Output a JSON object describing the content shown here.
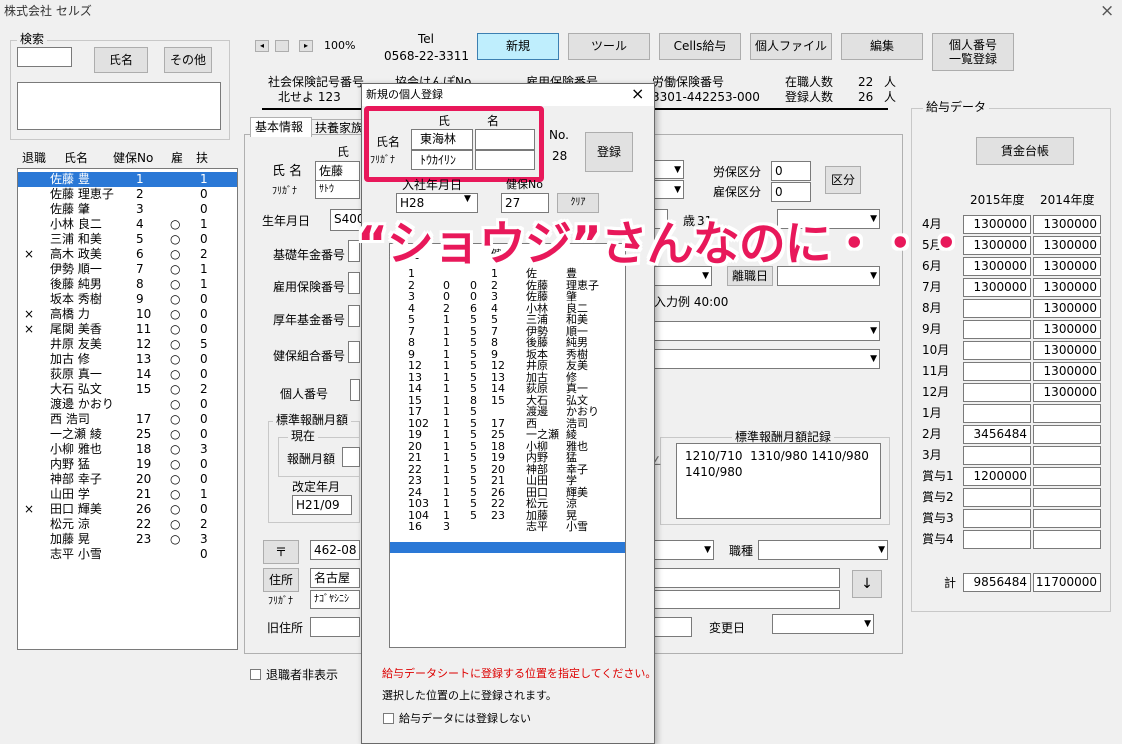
{
  "window": {
    "title": "株式会社 セルズ",
    "close": "×"
  },
  "search": {
    "legend": "検索",
    "name_btn": "氏名",
    "other_btn": "その他"
  },
  "nav": {
    "zoom": "100%",
    "tel_label": "Tel",
    "tel_value": "0568-22-3311"
  },
  "toolbar": {
    "new": "新規",
    "tool": "ツール",
    "cells_pay": "Cells給与",
    "personal_file": "個人ファイル",
    "edit": "編集",
    "my_number": "個人番号\n一覧登録"
  },
  "info": {
    "social_insurance_label": "社会保険記号番号",
    "social_insurance_value": "北せよ 123",
    "kyokai_label": "協会けんぽNo",
    "koyo_label": "雇用保険番号",
    "labor_label": "労働保険番号",
    "labor_value": "3301-442253-000",
    "employed_label": "在職人数",
    "employed_value": "22",
    "employed_unit": "人",
    "registered_label": "登録人数",
    "registered_value": "26",
    "registered_unit": "人"
  },
  "employee_list": {
    "headers": [
      "退職",
      "氏名",
      "健保No",
      "雇",
      "扶"
    ],
    "rows": [
      {
        "ret": "",
        "name": "佐藤 豊",
        "no": "1",
        "koyo": "",
        "fu": "1",
        "selected": true
      },
      {
        "ret": "",
        "name": "佐藤 理恵子",
        "no": "2",
        "koyo": "",
        "fu": "0"
      },
      {
        "ret": "",
        "name": "佐藤 肇",
        "no": "3",
        "koyo": "",
        "fu": "0"
      },
      {
        "ret": "",
        "name": "小林 良二",
        "no": "4",
        "koyo": "○",
        "fu": "1"
      },
      {
        "ret": "",
        "name": "三浦 和美",
        "no": "5",
        "koyo": "○",
        "fu": "0"
      },
      {
        "ret": "×",
        "name": "高木 政美",
        "no": "6",
        "koyo": "○",
        "fu": "2"
      },
      {
        "ret": "",
        "name": "伊勢 順一",
        "no": "7",
        "koyo": "○",
        "fu": "1"
      },
      {
        "ret": "",
        "name": "後藤 純男",
        "no": "8",
        "koyo": "○",
        "fu": "1"
      },
      {
        "ret": "",
        "name": "坂本 秀樹",
        "no": "9",
        "koyo": "○",
        "fu": "0"
      },
      {
        "ret": "×",
        "name": "高橋 力",
        "no": "10",
        "koyo": "○",
        "fu": "0"
      },
      {
        "ret": "×",
        "name": "尾関 美香",
        "no": "11",
        "koyo": "○",
        "fu": "0"
      },
      {
        "ret": "",
        "name": "井原 友美",
        "no": "12",
        "koyo": "○",
        "fu": "5"
      },
      {
        "ret": "",
        "name": "加古 修",
        "no": "13",
        "koyo": "○",
        "fu": "0"
      },
      {
        "ret": "",
        "name": "荻原 真一",
        "no": "14",
        "koyo": "○",
        "fu": "0"
      },
      {
        "ret": "",
        "name": "大石 弘文",
        "no": "15",
        "koyo": "○",
        "fu": "2"
      },
      {
        "ret": "",
        "name": "渡邊 かおり",
        "no": "",
        "koyo": "○",
        "fu": "0"
      },
      {
        "ret": "",
        "name": "西 浩司",
        "no": "17",
        "koyo": "○",
        "fu": "0"
      },
      {
        "ret": "",
        "name": "一之瀬 綾",
        "no": "25",
        "koyo": "○",
        "fu": "0"
      },
      {
        "ret": "",
        "name": "小柳 雅也",
        "no": "18",
        "koyo": "○",
        "fu": "3"
      },
      {
        "ret": "",
        "name": "内野 猛",
        "no": "19",
        "koyo": "○",
        "fu": "0"
      },
      {
        "ret": "",
        "name": "神部 幸子",
        "no": "20",
        "koyo": "○",
        "fu": "0"
      },
      {
        "ret": "",
        "name": "山田 学",
        "no": "21",
        "koyo": "○",
        "fu": "1"
      },
      {
        "ret": "×",
        "name": "田口 輝美",
        "no": "26",
        "koyo": "○",
        "fu": "0"
      },
      {
        "ret": "",
        "name": "松元 涼",
        "no": "22",
        "koyo": "○",
        "fu": "2"
      },
      {
        "ret": "",
        "name": "加藤 晃",
        "no": "23",
        "koyo": "○",
        "fu": "3"
      },
      {
        "ret": "",
        "name": "志平 小雪",
        "no": "",
        "koyo": "",
        "fu": "0"
      }
    ],
    "retired_hide": "退職者非表示"
  },
  "tabs": {
    "basic": "基本情報",
    "dependents": "扶養家族"
  },
  "form": {
    "shi": "氏",
    "name_label": "氏 名",
    "name_value": "佐藤",
    "kana_label": "ﾌﾘｶﾞﾅ",
    "kana_value": "ｻﾄｳ",
    "birth_label": "生年月日",
    "birth_value": "S400",
    "pension_label": "基礎年金番号",
    "koyo_label": "雇用保険番号",
    "kosei_label": "厚年基金番号",
    "kumiai_label": "健保組合番号",
    "mynumber_label": "個人番号",
    "rosai_label": "労保区分",
    "rosai_value": "0",
    "koyo_kubun_label": "雇保区分",
    "koyo_kubun_value": "0",
    "kubun_btn": "区分",
    "sai": "歳",
    "sai_num": "31",
    "retire_date": "離職日",
    "nyuryoku": "入力例 40:00",
    "hyojun_legend": "標準報酬月額",
    "genzai_legend": "現在",
    "hoshu_label": "報酬月額",
    "kaitei_label": "改定年月",
    "kaitei_value": "H21/09",
    "hyojun_record_label": "標準報酬月額記録",
    "hyojun_record_value": "1210/710  1310/980 1410/980\n1410/980",
    "zip_btn": "〒",
    "zip_value": "462-08",
    "job_label": "職種",
    "addr_btn": "住所",
    "addr_value": "名古屋",
    "addr_kana_label": "ﾌﾘｶﾞﾅ",
    "addr_kana_value": "ﾅｺﾞﾔｼﾆｼ",
    "old_addr_label": "旧住所",
    "change_label": "変更日",
    "arrow_down": "↓"
  },
  "salary": {
    "legend": "給与データ",
    "ledger_btn": "賃金台帳",
    "year1": "2015年度",
    "year2": "2014年度",
    "rows": [
      {
        "label": "4月",
        "v1": "1300000",
        "v2": "1300000"
      },
      {
        "label": "5月",
        "v1": "1300000",
        "v2": "1300000"
      },
      {
        "label": "6月",
        "v1": "1300000",
        "v2": "1300000"
      },
      {
        "label": "7月",
        "v1": "1300000",
        "v2": "1300000"
      },
      {
        "label": "8月",
        "v1": "",
        "v2": "1300000"
      },
      {
        "label": "9月",
        "v1": "",
        "v2": "1300000"
      },
      {
        "label": "10月",
        "v1": "",
        "v2": "1300000"
      },
      {
        "label": "11月",
        "v1": "",
        "v2": "1300000"
      },
      {
        "label": "12月",
        "v1": "",
        "v2": "1300000"
      },
      {
        "label": "1月",
        "v1": "",
        "v2": ""
      },
      {
        "label": "2月",
        "v1": "3456484",
        "v2": ""
      },
      {
        "label": "3月",
        "v1": "",
        "v2": ""
      },
      {
        "label": "賞与1",
        "v1": "1200000",
        "v2": ""
      },
      {
        "label": "賞与2",
        "v1": "",
        "v2": ""
      },
      {
        "label": "賞与3",
        "v1": "",
        "v2": ""
      },
      {
        "label": "賞与4",
        "v1": "",
        "v2": ""
      }
    ],
    "total_label": "計",
    "total_v1": "9856484",
    "total_v2": "11700000"
  },
  "dialog": {
    "title": "新規の個人登録",
    "close": "×",
    "shi": "氏",
    "mei": "名",
    "name_label": "氏名",
    "shi_value": "東海林",
    "mei_value": "",
    "kana_label": "ﾌﾘｶﾞﾅ",
    "kana_value": "ﾄｳｶｲﾘﾝ",
    "no_label": "No.",
    "no_value": "28",
    "register_btn": "登録",
    "join_label": "入社年月日",
    "join_value": "H28",
    "kenpo_label": "健保No",
    "kenpo_value": "27",
    "clear_btn": "ｸﾘｱ",
    "list_header": [
      "社",
      "",
      "",
      "健",
      "",
      ""
    ],
    "list_rows": [
      [
        "1",
        "",
        "",
        "1",
        "佐",
        "豊"
      ],
      [
        "2",
        "0",
        "0",
        "2",
        "佐藤",
        "理恵子"
      ],
      [
        "3",
        "0",
        "0",
        "3",
        "佐藤",
        "肇"
      ],
      [
        "4",
        "2",
        "6",
        "4",
        "小林",
        "良二"
      ],
      [
        "5",
        "1",
        "5",
        "5",
        "三浦",
        "和美"
      ],
      [
        "7",
        "1",
        "5",
        "7",
        "伊勢",
        "順一"
      ],
      [
        "8",
        "1",
        "5",
        "8",
        "後藤",
        "純男"
      ],
      [
        "9",
        "1",
        "5",
        "9",
        "坂本",
        "秀樹"
      ],
      [
        "12",
        "1",
        "5",
        "12",
        "井原",
        "友美"
      ],
      [
        "13",
        "1",
        "5",
        "13",
        "加古",
        "修"
      ],
      [
        "14",
        "1",
        "5",
        "14",
        "荻原",
        "真一"
      ],
      [
        "15",
        "1",
        "8",
        "15",
        "大石",
        "弘文"
      ],
      [
        "17",
        "1",
        "5",
        "",
        "渡邊",
        "かおり"
      ],
      [
        "102",
        "1",
        "5",
        "17",
        "西",
        "浩司"
      ],
      [
        "19",
        "1",
        "5",
        "25",
        "一之瀬",
        "綾"
      ],
      [
        "20",
        "1",
        "5",
        "18",
        "小柳",
        "雅也"
      ],
      [
        "21",
        "1",
        "5",
        "19",
        "内野",
        "猛"
      ],
      [
        "22",
        "1",
        "5",
        "20",
        "神部",
        "幸子"
      ],
      [
        "23",
        "1",
        "5",
        "21",
        "山田",
        "学"
      ],
      [
        "24",
        "1",
        "5",
        "26",
        "田口",
        "輝美"
      ],
      [
        "103",
        "1",
        "5",
        "22",
        "松元",
        "涼"
      ],
      [
        "104",
        "1",
        "5",
        "23",
        "加藤",
        "晃"
      ],
      [
        "16",
        "3",
        "",
        "",
        "志平",
        "小雪"
      ]
    ],
    "instruction": "給与データシートに登録する位置を指定してください。",
    "note": "選択した位置の上に登録されます。",
    "checkbox_label": "給与データには登録しない"
  },
  "annotation": {
    "text": "“ショウジ”さんなのに・・・",
    "color": "#e8185a"
  }
}
